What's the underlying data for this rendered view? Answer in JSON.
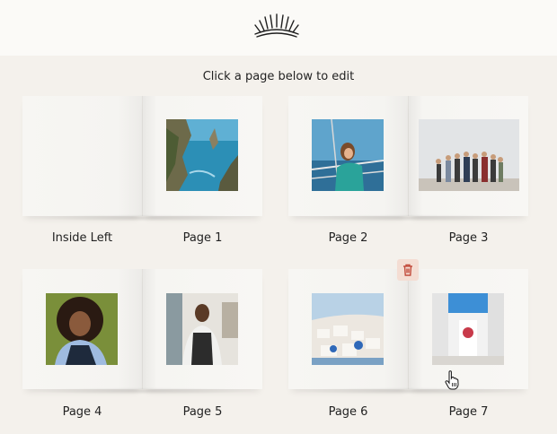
{
  "header": {
    "logo_icon": "sunburst-logo-icon"
  },
  "instruction": "Click a page below to edit",
  "spreads": [
    {
      "left_label": "Inside Left",
      "right_label": "Page 1"
    },
    {
      "left_label": "Page 2",
      "right_label": "Page 3"
    },
    {
      "left_label": "Page 4",
      "right_label": "Page 5"
    },
    {
      "left_label": "Page 6",
      "right_label": "Page 7"
    }
  ],
  "controls": {
    "delete_icon": "trash-icon",
    "cursor_icon": "hand-pointer-icon"
  }
}
